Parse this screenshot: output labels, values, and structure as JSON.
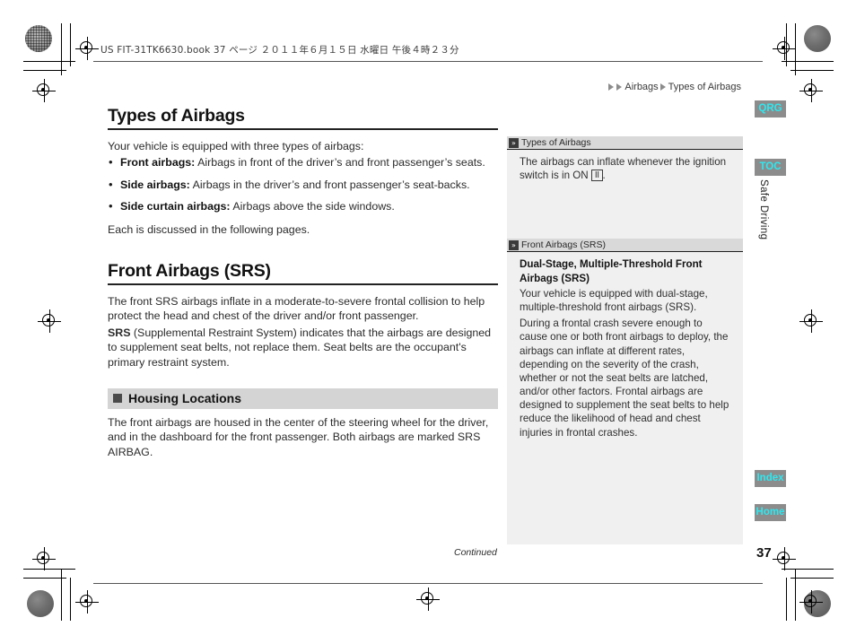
{
  "book_header": "US FIT-31TK6630.book   37 ページ   ２０１１年６月１５日   水曜日   午後４時２３分",
  "breadcrumb": {
    "item1": "Airbags",
    "item2": "Types of Airbags"
  },
  "main": {
    "section_title": "Types of Airbags",
    "intro": "Your vehicle is equipped with three types of airbags:",
    "bullets": [
      {
        "term": "Front airbags:",
        "desc": " Airbags in front of the driver’s and front passenger’s seats."
      },
      {
        "term": "Side airbags:",
        "desc": " Airbags in the driver’s and front passenger’s seat-backs."
      },
      {
        "term": "Side curtain airbags:",
        "desc": " Airbags above the side windows."
      }
    ],
    "closing": "Each is discussed in the following pages.",
    "sub_title": "Front Airbags (SRS)",
    "srs_para1": "The front SRS airbags inflate in a moderate-to-severe frontal collision to help protect the head and chest of the driver and/or front passenger.",
    "srs_term": "SRS",
    "srs_para2": " (Supplemental Restraint System) indicates that the airbags are designed to supplement seat belts, not replace them. Seat belts are the occupant's primary restraint system.",
    "housing_title": "Housing Locations",
    "housing_body": "The front airbags are housed in the center of the steering wheel for the driver, and in the dashboard for the front passenger. Both airbags are marked SRS AIRBAG."
  },
  "panel": {
    "head1": "Types of Airbags",
    "note1_a": "The airbags can inflate whenever the ignition switch is in ON ",
    "note1_key": "II",
    "note1_b": ".",
    "head2": "Front Airbags (SRS)",
    "note2_title": "Dual-Stage, Multiple-Threshold Front Airbags (SRS)",
    "note2_p1": "Your vehicle is equipped with dual-stage, multiple-threshold front airbags (SRS).",
    "note2_p2": "During a frontal crash severe enough to cause one or both front airbags to deploy, the airbags can inflate at different rates, depending on the severity of the crash, whether or not the seat belts are latched, and/or other factors. Frontal airbags are designed to supplement the seat belts to help reduce the likelihood of head and chest injuries in frontal crashes."
  },
  "rail": {
    "qrg": "QRG",
    "toc": "TOC",
    "index": "Index",
    "home": "Home",
    "chapter": "Safe Driving"
  },
  "footer": {
    "continued": "Continued",
    "page_number": "37"
  },
  "colors": {
    "rail_bg": "#8c8c8c",
    "rail_text": "#2de8f0",
    "panel_bg": "#f0f0f0",
    "panel_head_bg": "#d9d9d9",
    "housing_bar_bg": "#d4d4d4"
  }
}
